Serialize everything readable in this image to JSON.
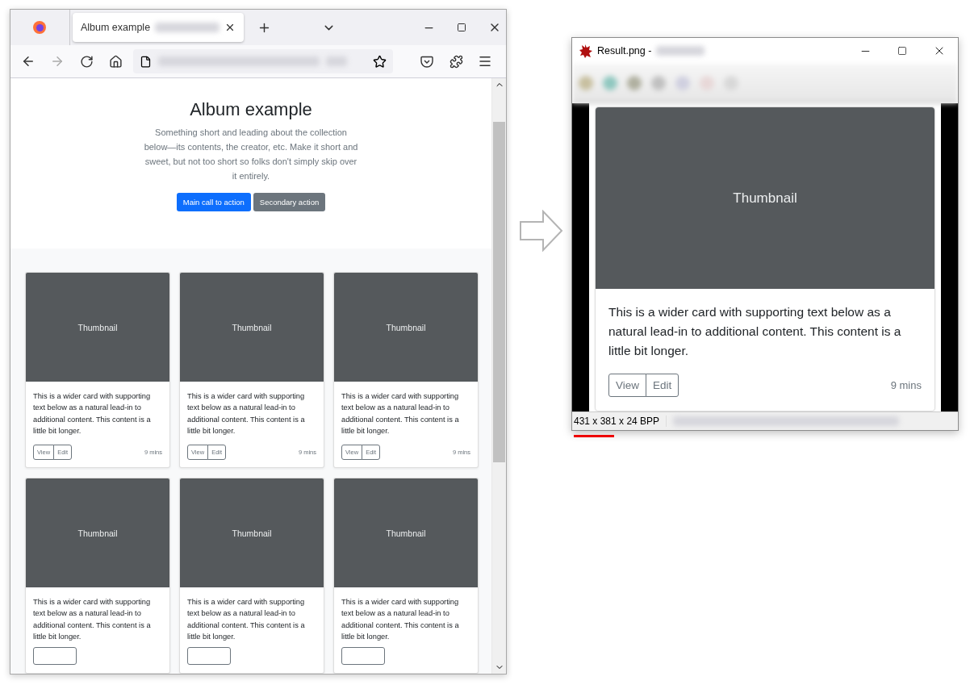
{
  "browser": {
    "tabs": [
      {
        "title": "Album example",
        "selected": true
      }
    ],
    "hero": {
      "title": "Album example",
      "lead": "Something short and leading about the collection below—its contents, the creator, etc. Make it short and sweet, but not too short so folks don't simply skip over it entirely.",
      "buttons": [
        {
          "label": "Main call to action",
          "kind": "primary"
        },
        {
          "label": "Secondary action",
          "kind": "secondary"
        }
      ]
    },
    "cards": [
      {
        "thumbnail": "Thumbnail",
        "text": "This is a wider card with supporting text below as a natural lead-in to additional content. This content is a little bit longer.",
        "buttons": [
          "View",
          "Edit"
        ],
        "time": "9 mins"
      },
      {
        "thumbnail": "Thumbnail",
        "text": "This is a wider card with supporting text below as a natural lead-in to additional content. This content is a little bit longer.",
        "buttons": [
          "View",
          "Edit"
        ],
        "time": "9 mins"
      },
      {
        "thumbnail": "Thumbnail",
        "text": "This is a wider card with supporting text below as a natural lead-in to additional content. This content is a little bit longer.",
        "buttons": [
          "View",
          "Edit"
        ],
        "time": "9 mins"
      },
      {
        "thumbnail": "Thumbnail",
        "text": "This is a wider card with supporting text below as a natural lead-in to additional content. This content is a little bit longer."
      },
      {
        "thumbnail": "Thumbnail",
        "text": "This is a wider card with supporting text below as a natural lead-in to additional content. This content is a little bit longer."
      },
      {
        "thumbnail": "Thumbnail",
        "text": "This is a wider card with supporting text below as a natural lead-in to additional content. This content is a little bit longer."
      }
    ]
  },
  "viewer": {
    "title": "Result.png -",
    "card": {
      "thumbnail": "Thumbnail",
      "text": "This is a wider card with supporting text below as a natural lead-in to additional content. This content is a little bit longer.",
      "buttons": [
        "View",
        "Edit"
      ],
      "time": "9 mins"
    },
    "status": "431 x 381 x 24 BPP"
  }
}
